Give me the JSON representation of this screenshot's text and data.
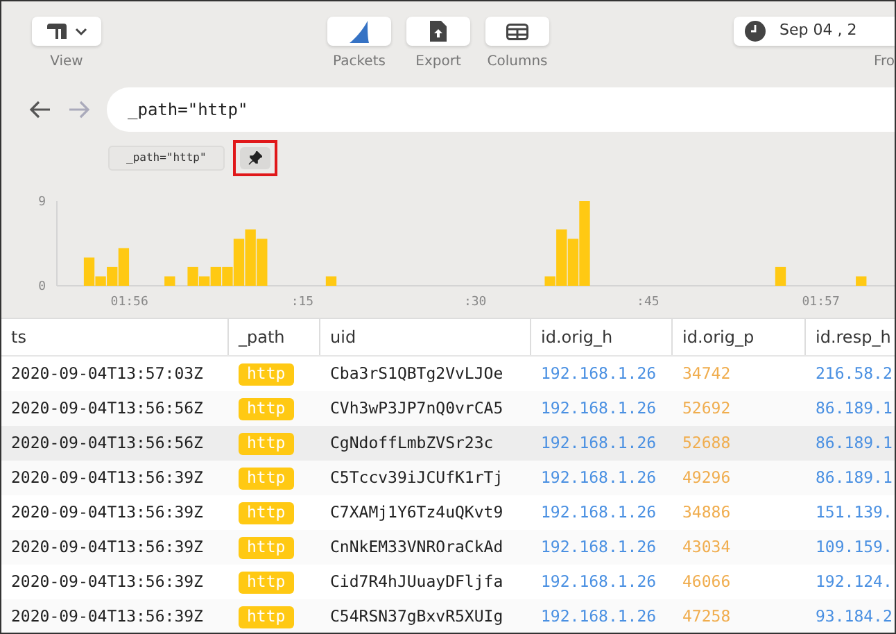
{
  "toolbar": {
    "view": {
      "label": "View"
    },
    "actions": [
      {
        "kind": "packets",
        "label": "Packets"
      },
      {
        "kind": "export",
        "label": "Export"
      },
      {
        "kind": "columns",
        "label": "Columns"
      }
    ],
    "date": {
      "value": "Sep 04 , 2",
      "label": "Fro"
    }
  },
  "search": {
    "value": "_path=\"http\""
  },
  "pins": [
    {
      "label": "_path=\"http\""
    }
  ],
  "chart": {
    "chart_data": {
      "type": "bar",
      "x": [
        115.9417,
        115.9583,
        115.975,
        115.9917,
        116.0583,
        116.0917,
        116.1083,
        116.125,
        116.1417,
        116.1583,
        116.175,
        116.1917,
        116.2917,
        116.6083,
        116.625,
        116.6417,
        116.6583,
        116.9417,
        117.0583
      ],
      "values": [
        3,
        1,
        2,
        4,
        1,
        2,
        1,
        2,
        2,
        5,
        6,
        5,
        1,
        1,
        6,
        5,
        9,
        2,
        1
      ],
      "xlim": [
        115.895,
        117.1067
      ],
      "ylim": [
        0,
        9
      ],
      "yticks": [
        0,
        9
      ],
      "xticks": [
        {
          "value": 116,
          "label": "01:56"
        },
        {
          "value": 117,
          "label": "01:57"
        }
      ]
    },
    "minor_tick_labels": [
      ":15",
      ":30",
      ":45"
    ]
  },
  "table": {
    "columns": [
      "ts",
      "_path",
      "uid",
      "id.orig_h",
      "id.orig_p",
      "id.resp_h"
    ],
    "rows": [
      {
        "selected": false,
        "cells": [
          "2020-09-04T13:57:03Z",
          "http",
          "Cba3rS1QBTg2VvLJOe",
          "192.168.1.26",
          "34742",
          "216.58.2"
        ]
      },
      {
        "selected": false,
        "cells": [
          "2020-09-04T13:56:56Z",
          "http",
          "CVh3wP3JP7nQ0vrCA5",
          "192.168.1.26",
          "52692",
          "86.189.1"
        ]
      },
      {
        "selected": true,
        "cells": [
          "2020-09-04T13:56:56Z",
          "http",
          "CgNdoffLmbZVSr23c",
          "192.168.1.26",
          "52688",
          "86.189.1"
        ]
      },
      {
        "selected": false,
        "cells": [
          "2020-09-04T13:56:39Z",
          "http",
          "C5Tccv39iJCUfK1rTj",
          "192.168.1.26",
          "49296",
          "86.189.1"
        ]
      },
      {
        "selected": false,
        "cells": [
          "2020-09-04T13:56:39Z",
          "http",
          "C7XAMj1Y6Tz4uQKvt9",
          "192.168.1.26",
          "34886",
          "151.139."
        ]
      },
      {
        "selected": false,
        "cells": [
          "2020-09-04T13:56:39Z",
          "http",
          "CnNkEM33VNROraCkAd",
          "192.168.1.26",
          "43034",
          "109.159."
        ]
      },
      {
        "selected": false,
        "cells": [
          "2020-09-04T13:56:39Z",
          "http",
          "Cid7R4hJUuayDFljfa",
          "192.168.1.26",
          "46066",
          "192.124."
        ]
      },
      {
        "selected": false,
        "cells": [
          "2020-09-04T13:56:39Z",
          "http",
          "C54RSN37gBxvR5XUIg",
          "192.168.1.26",
          "47258",
          "93.184.2"
        ]
      }
    ]
  }
}
